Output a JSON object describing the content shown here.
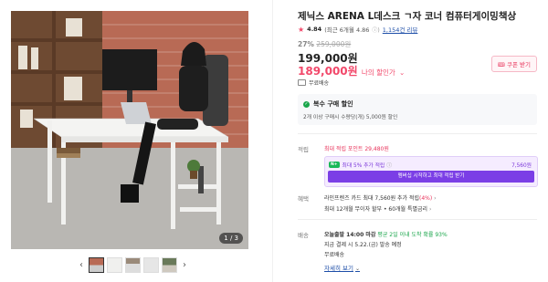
{
  "gallery": {
    "counter": "1 / 3",
    "thumbnail_count": 5
  },
  "product": {
    "title": "제닉스 ARENA L데스크 ㄱ자 코너 컴퓨터게이밍책상",
    "rating": {
      "score": "4.84",
      "detail": "(최근 6개월 4.86",
      "reviews": "1,154건 리뷰"
    },
    "discount_rate": "27%",
    "original_price": "259,000원",
    "price": "199,000원",
    "my_price": "189,000원",
    "my_price_label": "나의 할인가",
    "coupon_button": "쿠폰 받기",
    "free_shipping": "무료배송"
  },
  "multi_purchase": {
    "title": "복수 구매 할인",
    "detail": "2개 이상 구매시 수량당(개) 5,000원 할인"
  },
  "points": {
    "label": "적립",
    "max_points": "최대 적립 포인트 29,480원",
    "npay_row": "최대 5% 추가 적립",
    "npay_amount": "7,560원",
    "npay_button": "멤버십 시작하고 최대 적립 받기"
  },
  "benefits": {
    "label": "혜택",
    "line1_a": "라인프렌즈 카드 최대 7,560원 추가 적립",
    "line1_b": "(4%)",
    "line2": "최대 12개월 무이자 할부 • 60개월 특별금리"
  },
  "delivery": {
    "label": "배송",
    "line1_a": "오늘출발 14:00 마감",
    "line1_b": "평균 2일 이내 도착 확률 93%",
    "line2": "지금 결제 시 5.22.(금) 발송 예정",
    "line3": "무료배송"
  },
  "more_link": "자세히 보기",
  "colors": {
    "accent_pink": "#f2486a",
    "npay_purple": "#7b3ee6",
    "link_blue": "#1d4ea8"
  }
}
